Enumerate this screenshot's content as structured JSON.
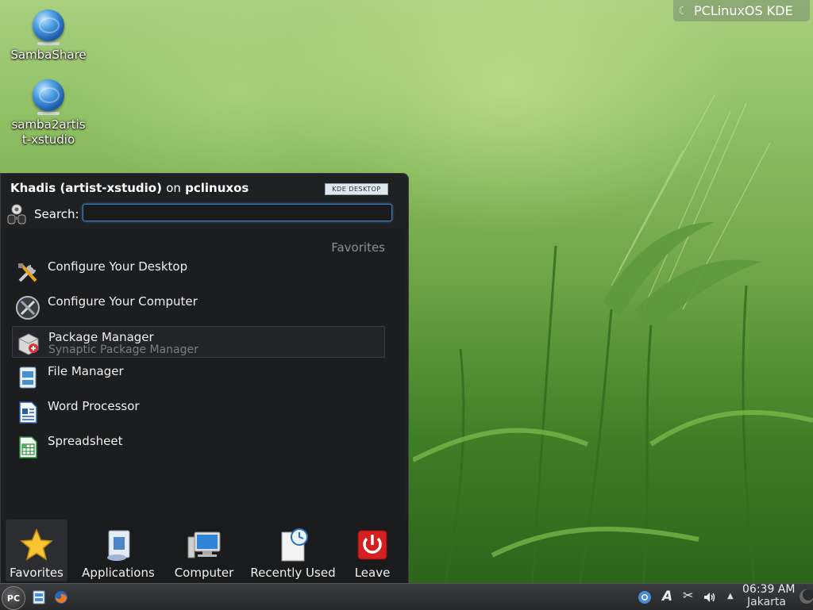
{
  "desktop": {
    "icons": [
      {
        "label": "SambaShare",
        "icon": "network-globe-icon"
      },
      {
        "label": "samba2artis\nt-xstudio",
        "icon": "network-globe-icon"
      }
    ],
    "top_widget": {
      "label": "PCLinuxOS KDE",
      "icon": "moon-icon"
    }
  },
  "menu": {
    "user": "Khadis (artist-xstudio)",
    "on_text": "on",
    "host": "pclinuxos",
    "badge": "KDE DESKTOP",
    "search_label": "Search:",
    "search_value": "",
    "favorites_title": "Favorites",
    "favorites": [
      {
        "name": "Configure Your Desktop",
        "sub": "",
        "icon": "tools-icon"
      },
      {
        "name": "Configure Your Computer",
        "sub": "",
        "icon": "system-settings-icon"
      },
      {
        "name": "Package Manager",
        "sub": "Synaptic Package Manager",
        "icon": "package-icon"
      },
      {
        "name": "File Manager",
        "sub": "",
        "icon": "file-manager-icon"
      },
      {
        "name": "Word Processor",
        "sub": "",
        "icon": "writer-icon"
      },
      {
        "name": "Spreadsheet",
        "sub": "",
        "icon": "calc-icon"
      }
    ],
    "tabs": [
      {
        "label": "Favorites",
        "icon": "star-icon",
        "active": true
      },
      {
        "label": "Applications",
        "icon": "applications-icon",
        "active": false
      },
      {
        "label": "Computer",
        "icon": "computer-icon",
        "active": false
      },
      {
        "label": "Recently Used",
        "icon": "recent-icon",
        "active": false
      },
      {
        "label": "Leave",
        "icon": "power-icon",
        "active": false
      }
    ]
  },
  "taskbar": {
    "start_label": "PC",
    "clock_time": "06:39 AM",
    "clock_zone": "Jakarta"
  },
  "colors": {
    "accent": "#3c7fbf",
    "menu_bg": "#1f2022"
  }
}
